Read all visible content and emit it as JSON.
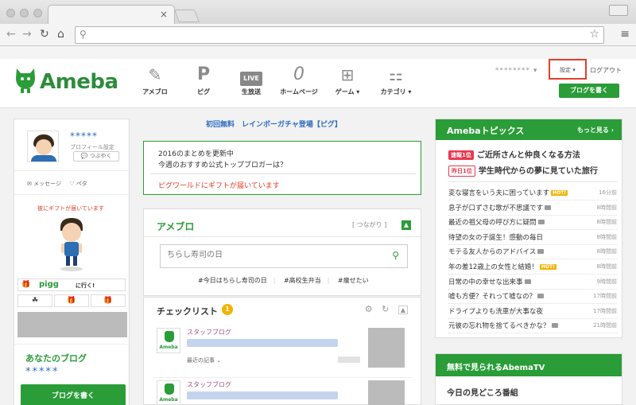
{
  "browser": {
    "tab_close": "×",
    "menu": "≡"
  },
  "header": {
    "logo": "Ameba",
    "nav": [
      {
        "label": "アメブロ",
        "icon": "pencil-icon"
      },
      {
        "label": "ピグ",
        "icon": "pigg-icon"
      },
      {
        "label": "生放送",
        "icon": "live-icon",
        "badge": "LIVE"
      },
      {
        "label": "ホームページ",
        "icon": "homepage-icon"
      },
      {
        "label": "ゲーム ▾",
        "icon": "gamepad-icon"
      },
      {
        "label": "カテゴリ ▾",
        "icon": "category-icon"
      }
    ],
    "user_name": "******** ▾",
    "settings": "設定 ▾",
    "logout": "ログアウト",
    "write_blog": "ブログを書く"
  },
  "left": {
    "profile_name": "*****",
    "profile_setting": "プロフィール設定",
    "tsubuyaku": "つぶやく",
    "message": "メッセージ",
    "peta": "ペタ",
    "gift_notice": "彼にギフトが届いています",
    "pigg_logo": "pigg",
    "pigg_go": "に行く!",
    "your_blog": "あなたのブログ",
    "blog_name": "*****",
    "write_blog": "ブログを書く"
  },
  "center": {
    "promo": "初回無料　レインボーガチャ登場【ピグ】",
    "notice_1": "2016のまとめを更新中",
    "notice_2": "今週のおすすめ公式トップブロガーは？",
    "notice_red": "ピグワールドにギフトが届いています",
    "ameblo_title": "アメブロ",
    "tsunagari": "[ つながり ]",
    "search_placeholder": "ちらし寿司の日",
    "hashtags": [
      "#今日はちらし寿司の日",
      "#高校生弁当",
      "#痩せたい"
    ],
    "checklist_title": "チェックリスト",
    "checklist_count": "1",
    "posts": [
      {
        "category": "スタッフブログ",
        "recent": "最近の記事 ⌄",
        "logo": "Ameba"
      },
      {
        "category": "スタッフブログ",
        "logo": "Ameba"
      }
    ]
  },
  "right": {
    "topics_title": "Amebaトピックス",
    "topics_more": "もっと見る ›",
    "rank_1_badge": "速報1位",
    "rank_1_text": "ご近所さんと仲良くなる方法",
    "rank_y_badge": "昨日1位",
    "rank_y_text": "学生時代からの夢に見ていた旅行",
    "topics": [
      {
        "text": "変な寝言をいう夫に困っています",
        "hot": true,
        "time": "16分前"
      },
      {
        "text": "息子が口ずさむ歌が不思議です",
        "cam": true,
        "time": "8時間前"
      },
      {
        "text": "最近の祖父母の呼び方に疑問",
        "cam": true,
        "time": "8時間前"
      },
      {
        "text": "待望の女の子誕生！感動の毎日",
        "time": "8時間前"
      },
      {
        "text": "モテる友人からのアドバイス",
        "cam": true,
        "time": "8時間前"
      },
      {
        "text": "年の差12歳上の女性と結婚！",
        "hot": true,
        "time": "8時間前"
      },
      {
        "text": "日常の中の幸せな出来事",
        "cam": true,
        "time": "9時間前"
      },
      {
        "text": "嘘も方便？それって嘘なの？",
        "cam": true,
        "time": "17時間前"
      },
      {
        "text": "ドライブよりも洗車が大事な夜",
        "time": "17時間前"
      },
      {
        "text": "元彼の忘れ物を捨てるべきかな？",
        "cam": true,
        "time": "21時間前"
      }
    ],
    "abema_title": "無料で見られるAbemaTV",
    "abema_sub": "今日の見どころ番組",
    "hot_label": "HOT!"
  }
}
